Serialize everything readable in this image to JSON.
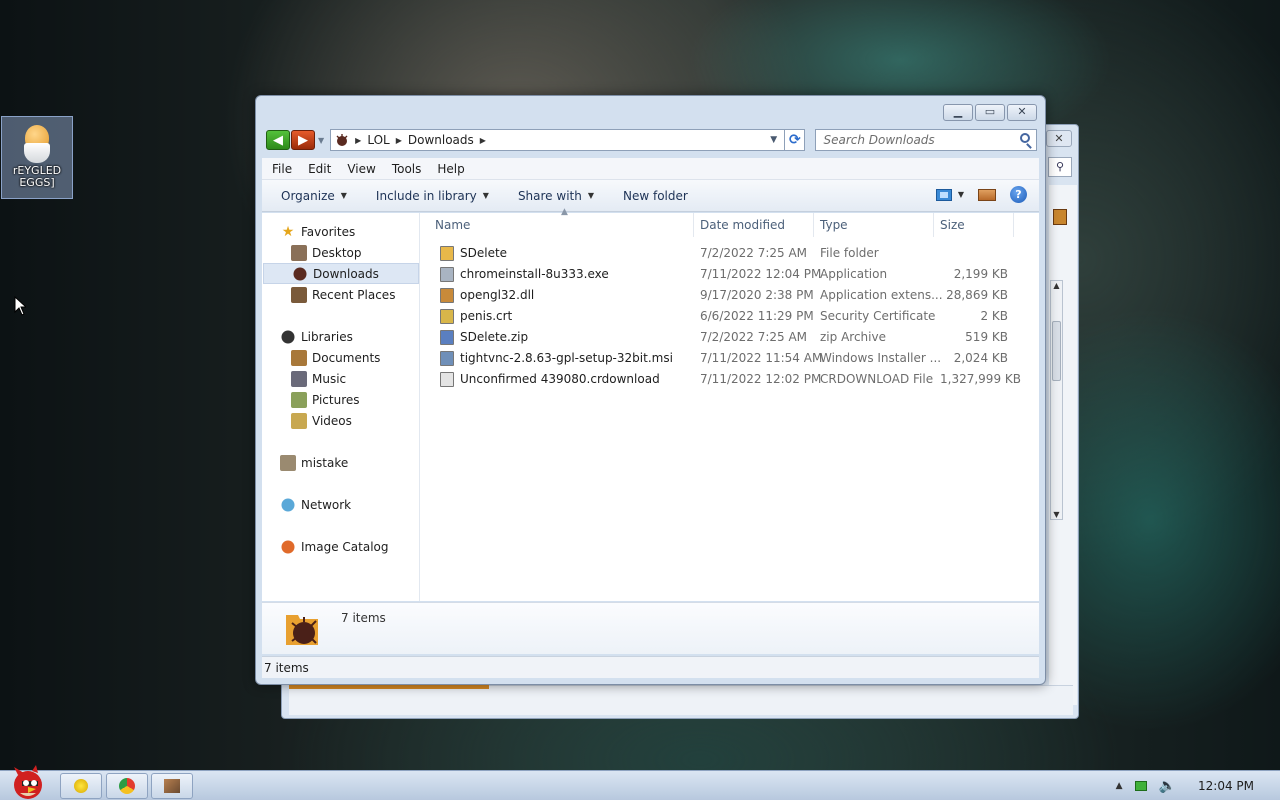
{
  "desktop": {
    "icon_label": "rEYGLED EGGS]"
  },
  "window": {
    "address": [
      "LOL",
      "Downloads"
    ],
    "search_placeholder": "Search Downloads",
    "menu": [
      "File",
      "Edit",
      "View",
      "Tools",
      "Help"
    ],
    "toolbar": {
      "organize": "Organize",
      "include_in_library": "Include in library",
      "share_with": "Share with",
      "new_folder": "New folder"
    },
    "nav": {
      "favorites": "Favorites",
      "desktop": "Desktop",
      "downloads": "Downloads",
      "recent_places": "Recent Places",
      "libraries": "Libraries",
      "documents": "Documents",
      "music": "Music",
      "pictures": "Pictures",
      "videos": "Videos",
      "user": "mistake",
      "network": "Network",
      "image_catalog": "Image Catalog"
    },
    "columns": {
      "name": "Name",
      "date": "Date modified",
      "type": "Type",
      "size": "Size"
    },
    "files": [
      {
        "name": "SDelete",
        "date": "7/2/2022 7:25 AM",
        "type": "File folder",
        "size": "",
        "icon": "folder-icon",
        "color": "#e8b84a"
      },
      {
        "name": "chromeinstall-8u333.exe",
        "date": "7/11/2022 12:04 PM",
        "type": "Application",
        "size": "2,199 KB",
        "icon": "exe-icon",
        "color": "#a9b4c2"
      },
      {
        "name": "opengl32.dll",
        "date": "9/17/2020 2:38 PM",
        "type": "Application extens...",
        "size": "28,869 KB",
        "icon": "dll-icon",
        "color": "#c88a3a"
      },
      {
        "name": "penis.crt",
        "date": "6/6/2022 11:29 PM",
        "type": "Security Certificate",
        "size": "2 KB",
        "icon": "certificate-icon",
        "color": "#d8b64a"
      },
      {
        "name": "SDelete.zip",
        "date": "7/2/2022 7:25 AM",
        "type": "zip Archive",
        "size": "519 KB",
        "icon": "zip-icon",
        "color": "#5a7fc0"
      },
      {
        "name": "tightvnc-2.8.63-gpl-setup-32bit.msi",
        "date": "7/11/2022 11:54 AM",
        "type": "Windows Installer ...",
        "size": "2,024 KB",
        "icon": "msi-icon",
        "color": "#6f8fb8"
      },
      {
        "name": "Unconfirmed 439080.crdownload",
        "date": "7/11/2022 12:02 PM",
        "type": "CRDOWNLOAD File",
        "size": "1,327,999 KB",
        "icon": "file-icon",
        "color": "#e4e4e4"
      }
    ],
    "details_count": "7 items",
    "status": "7 items"
  },
  "taskbar": {
    "clock": "12:04 PM"
  }
}
